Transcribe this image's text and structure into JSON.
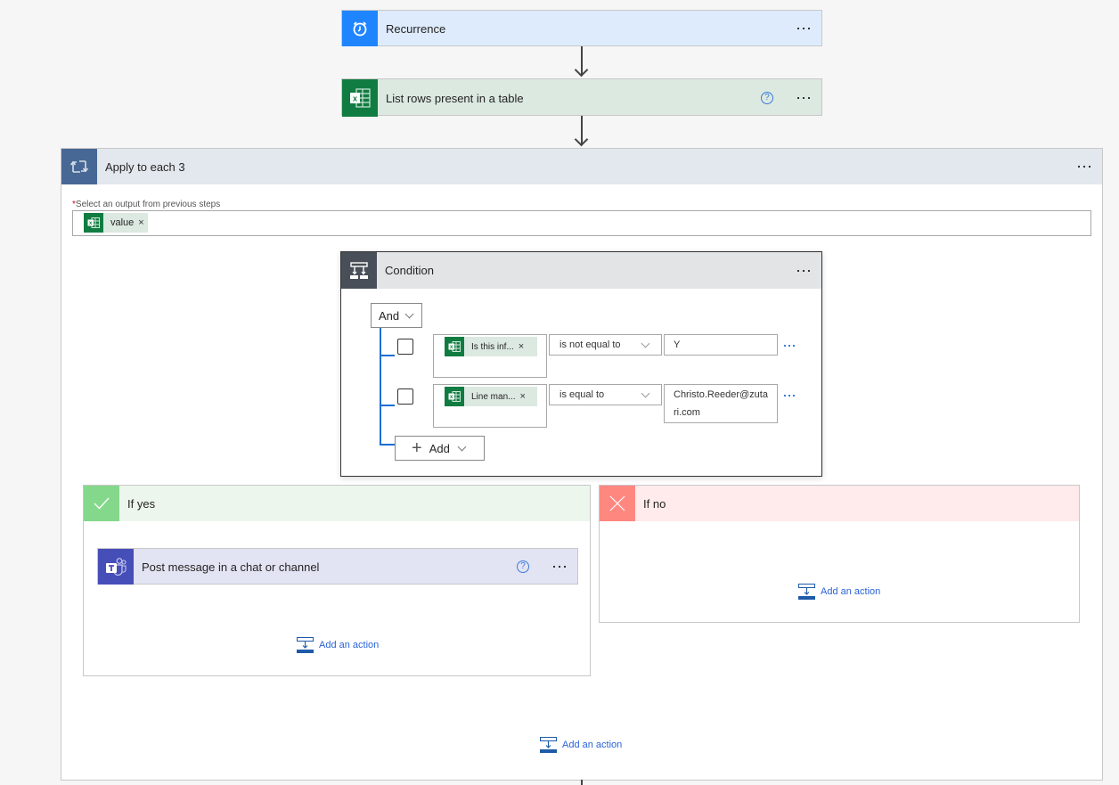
{
  "flow": {
    "recurrence": {
      "title": "Recurrence",
      "icon": "alarm-clock-icon"
    },
    "list_rows": {
      "title": "List rows present in a table",
      "icon": "excel-icon",
      "help": "?"
    },
    "apply_to_each": {
      "title": "Apply to each 3",
      "icon": "loop-icon",
      "required_marker": "*",
      "select_label": "Select an output from previous steps",
      "selected_token": {
        "label": "value",
        "remove": "×"
      },
      "add_action_label": "Add an action",
      "condition": {
        "title": "Condition",
        "icon": "condition-icon",
        "group_operator": "And",
        "rows": [
          {
            "operand": "Is this inf...",
            "operator": "is not equal to",
            "value": "Y"
          },
          {
            "operand": "Line man...",
            "operator": "is equal to",
            "value": "Christo.Reeder@zutari.com"
          }
        ],
        "token_remove": "×",
        "add_label": "Add",
        "add_plus": "+"
      },
      "if_yes": {
        "title": "If yes",
        "icon": "checkmark-icon",
        "actions": [
          {
            "title": "Post message in a chat or channel",
            "icon": "teams-icon",
            "help": "?"
          }
        ],
        "add_action_label": "Add an action"
      },
      "if_no": {
        "title": "If no",
        "icon": "close-icon",
        "add_action_label": "Add an action"
      }
    }
  },
  "colors": {
    "recurrence_accent": "#1f85ff",
    "excel_accent": "#107c41",
    "loop_accent": "#476894",
    "condition_accent": "#484f58",
    "yes_accent": "#84d88b",
    "no_accent": "#fe8780",
    "teams_accent": "#464eb8",
    "link": "#2a62d6"
  }
}
